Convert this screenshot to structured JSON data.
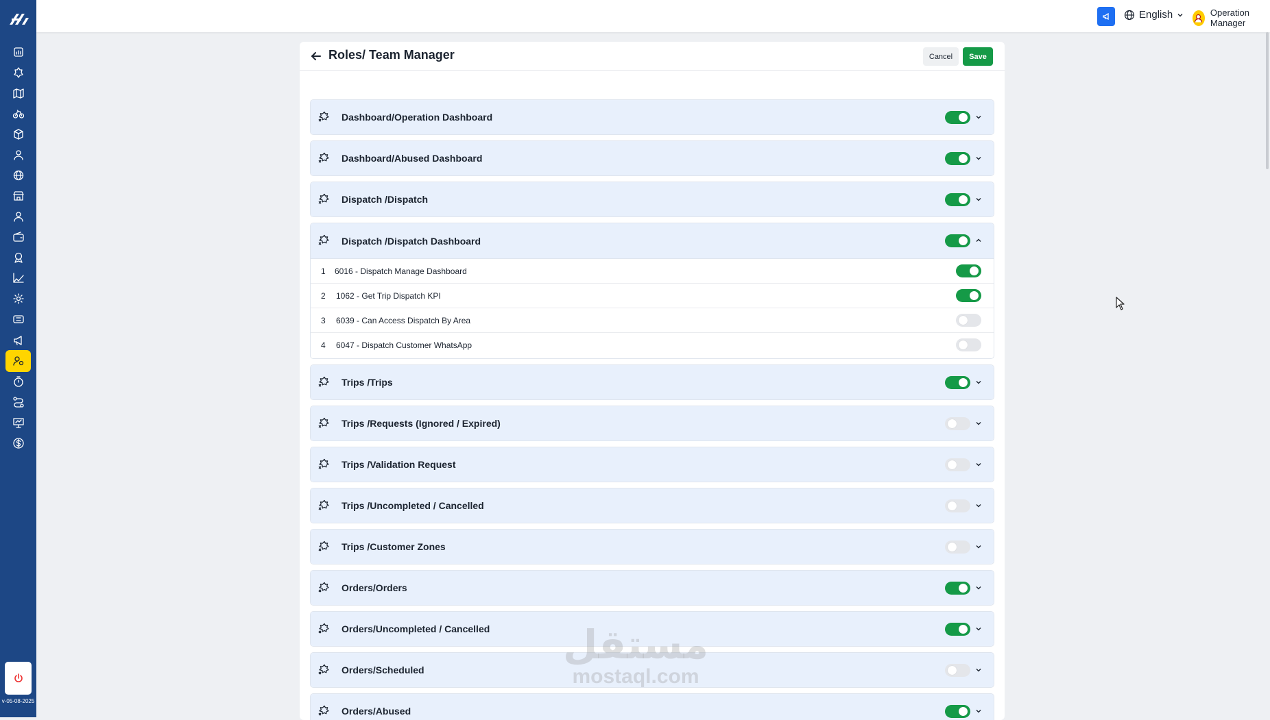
{
  "sidebar": {
    "logo": "app-logo",
    "items": [
      {
        "icon": "dashboard-icon",
        "active": false
      },
      {
        "icon": "dispatch-icon",
        "active": false
      },
      {
        "icon": "map-icon",
        "active": false
      },
      {
        "icon": "bike-icon",
        "active": false
      },
      {
        "icon": "box-icon",
        "active": false
      },
      {
        "icon": "driver-icon",
        "active": false
      },
      {
        "icon": "globe-icon",
        "active": false
      },
      {
        "icon": "store-icon",
        "active": false
      },
      {
        "icon": "user-icon",
        "active": false
      },
      {
        "icon": "wallet-icon",
        "active": false
      },
      {
        "icon": "award-icon",
        "active": false
      },
      {
        "icon": "chart-icon",
        "active": false
      },
      {
        "icon": "settings-icon",
        "active": false
      },
      {
        "icon": "ticket-icon",
        "active": false
      },
      {
        "icon": "megaphone-icon",
        "active": false
      },
      {
        "icon": "roles-icon",
        "active": true
      },
      {
        "icon": "timer-icon",
        "active": false
      },
      {
        "icon": "route-icon",
        "active": false
      },
      {
        "icon": "presentation-icon",
        "active": false
      },
      {
        "icon": "dollar-icon",
        "active": false
      }
    ],
    "version": "v-05-08-2025"
  },
  "topbar": {
    "language": "English",
    "user_name": "Operation Manager"
  },
  "page": {
    "title": "Roles/ Team Manager",
    "cancel_label": "Cancel",
    "save_label": "Save"
  },
  "permissions": [
    {
      "title": "Dashboard/Operation Dashboard",
      "enabled": true,
      "expanded": false
    },
    {
      "title": "Dashboard/Abused Dashboard",
      "enabled": true,
      "expanded": false
    },
    {
      "title": "Dispatch /Dispatch",
      "enabled": true,
      "expanded": false
    },
    {
      "title": "Dispatch /Dispatch Dashboard",
      "enabled": true,
      "expanded": true,
      "items": [
        {
          "index": "1",
          "label": "6016 - Dispatch Manage Dashboard",
          "enabled": true
        },
        {
          "index": "2",
          "label": "1062 - Get Trip Dispatch KPI",
          "enabled": true
        },
        {
          "index": "3",
          "label": "6039 - Can Access Dispatch By Area",
          "enabled": false
        },
        {
          "index": "4",
          "label": "6047 - Dispatch Customer WhatsApp",
          "enabled": false
        }
      ]
    },
    {
      "title": "Trips /Trips",
      "enabled": true,
      "expanded": false
    },
    {
      "title": "Trips /Requests (Ignored / Expired)",
      "enabled": false,
      "expanded": false
    },
    {
      "title": "Trips /Validation Request",
      "enabled": false,
      "expanded": false
    },
    {
      "title": "Trips /Uncompleted / Cancelled",
      "enabled": false,
      "expanded": false
    },
    {
      "title": "Trips /Customer Zones",
      "enabled": false,
      "expanded": false
    },
    {
      "title": "Orders/Orders",
      "enabled": true,
      "expanded": false
    },
    {
      "title": "Orders/Uncompleted / Cancelled",
      "enabled": true,
      "expanded": false
    },
    {
      "title": "Orders/Scheduled",
      "enabled": false,
      "expanded": false
    },
    {
      "title": "Orders/Abused",
      "enabled": true,
      "expanded": false
    }
  ],
  "watermark": {
    "arabic": "مستقل",
    "latin": "mostaql.com"
  },
  "colors": {
    "sidebar": "#1d4785",
    "active_nav": "#ffd500",
    "toggle_on": "#159a47",
    "toggle_off": "#e4e6ea",
    "save_button": "#159a47",
    "group_header": "#e8f0fc"
  }
}
